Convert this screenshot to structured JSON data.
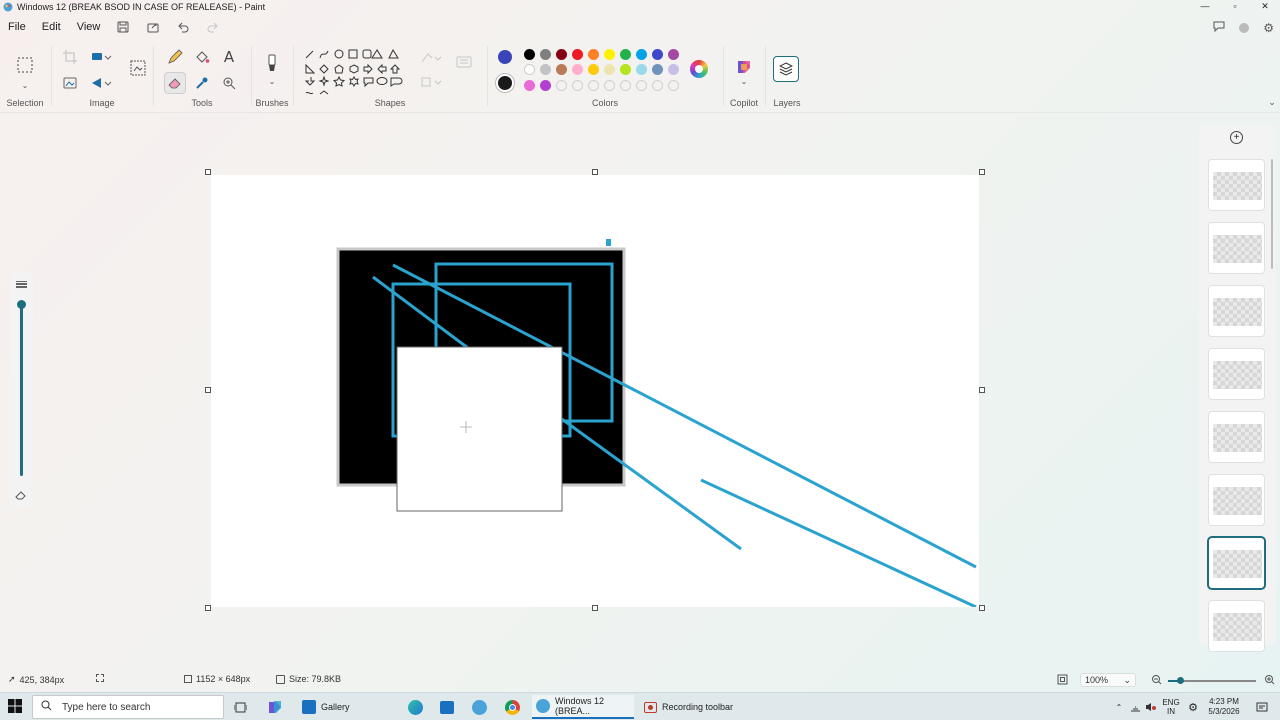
{
  "window": {
    "title": "Windows 12 (BREAK BSOD IN CASE OF REALEASE) - Paint"
  },
  "menu": {
    "file": "File",
    "edit": "Edit",
    "view": "View"
  },
  "ribbon": {
    "groups": {
      "selection": "Selection",
      "image": "Image",
      "tools": "Tools",
      "brushes": "Brushes",
      "shapes": "Shapes",
      "colors": "Colors",
      "copilot": "Copilot",
      "layers": "Layers"
    },
    "text_tool_glyph": "A",
    "colors": {
      "primary": "#1a1a1a",
      "secondary": "#ffffff",
      "active_indicator": "#3a44b8",
      "palette_row1": [
        "#000000",
        "#7f7f7f",
        "#880015",
        "#ed1c24",
        "#ff7f27",
        "#fff200",
        "#22b14c",
        "#00a2e8",
        "#3f48cc",
        "#a349a4"
      ],
      "palette_row2": [
        "#ffffff",
        "#c3c3c3",
        "#b97a57",
        "#ffaec9",
        "#ffc90e",
        "#efe4b0",
        "#b5e61d",
        "#99d9ea",
        "#7092be",
        "#c8bfe7"
      ],
      "palette_row3": [
        "#e86bd6",
        "#b23fd0"
      ]
    }
  },
  "canvas": {
    "stroke_color": "#2aa3cf"
  },
  "layers": {
    "count": 8,
    "selected_index": 6
  },
  "status": {
    "cursor_pos": "425, 384px",
    "canvas_size": "1152 × 648px",
    "file_size": "Size: 79.8KB",
    "zoom": "100%",
    "zoom_level": 0.45
  },
  "taskbar": {
    "search_placeholder": "Type here to search",
    "apps": {
      "gallery": "Gallery",
      "paint": "Windows 12 (BREA...",
      "recording": "Recording toolbar"
    },
    "lang_line1": "ENG",
    "lang_line2": "IN",
    "time": "4:23 PM",
    "date": "5/3/2026"
  }
}
